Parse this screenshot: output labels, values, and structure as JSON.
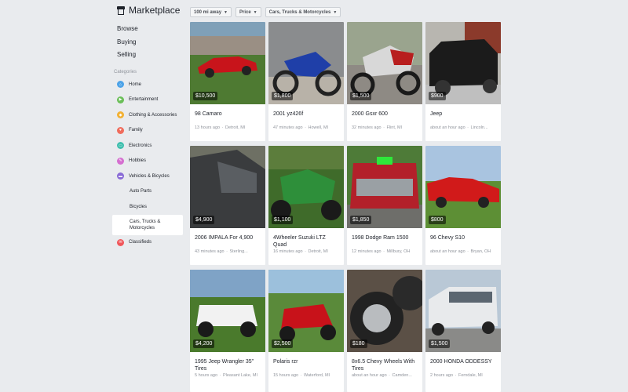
{
  "brand": {
    "title": "Marketplace"
  },
  "nav": [
    {
      "label": "Browse"
    },
    {
      "label": "Buying"
    },
    {
      "label": "Selling"
    }
  ],
  "categories_heading": "Categories",
  "categories": [
    {
      "label": "Home",
      "icon": "home-icon",
      "color": "#4da3e8"
    },
    {
      "label": "Entertainment",
      "icon": "entertainment-icon",
      "color": "#6bbf59"
    },
    {
      "label": "Clothing & Accessories",
      "icon": "clothing-icon",
      "color": "#f2b134"
    },
    {
      "label": "Family",
      "icon": "heart-icon",
      "color": "#f06c5c"
    },
    {
      "label": "Electronics",
      "icon": "electronics-icon",
      "color": "#3fbfae"
    },
    {
      "label": "Hobbies",
      "icon": "hobbies-icon",
      "color": "#d56fd0"
    },
    {
      "label": "Vehicles & Bicycles",
      "icon": "vehicle-icon",
      "color": "#8a6bd6"
    },
    {
      "label": "Auto Parts",
      "sub": true
    },
    {
      "label": "Bicycles",
      "sub": true
    },
    {
      "label": "Cars, Trucks & Motorcycles",
      "sub": true,
      "selected": true
    },
    {
      "label": "Classifieds",
      "icon": "classifieds-icon",
      "color": "#f0565a"
    }
  ],
  "filters": [
    {
      "label": "100 mi away"
    },
    {
      "label": "Price"
    },
    {
      "label": "Cars, Trucks & Motorcycles"
    }
  ],
  "listings": [
    {
      "price": "$10,500",
      "title": "98 Camaro",
      "time": "13 hours ago",
      "location": "Detroit, MI"
    },
    {
      "price": "$1,800",
      "title": "2001 yz426f",
      "time": "47 minutes ago",
      "location": "Howell, MI"
    },
    {
      "price": "$1,500",
      "title": "2000 Gsxr 600",
      "time": "32 minutes ago",
      "location": "Flint, MI"
    },
    {
      "price": "$900",
      "title": "Jeep",
      "time": "about an hour ago",
      "location": "Lincoln..."
    },
    {
      "price": "$4,900",
      "title": "2006 IMPALA For 4,900",
      "time": "43 minutes ago",
      "location": "Sterling..."
    },
    {
      "price": "$1,100",
      "title": "4Wheeler Suzuki LTZ Quad",
      "time": "16 minutes ago",
      "location": "Detroit, MI"
    },
    {
      "price": "$1,850",
      "title": "1998 Dodge Ram 1500",
      "time": "12 minutes ago",
      "location": "Millbury, OH"
    },
    {
      "price": "$800",
      "title": "96 Chevy S10",
      "time": "about an hour ago",
      "location": "Bryan, OH"
    },
    {
      "price": "$4,200",
      "title": "1995 Jeep Wrangler 35\" Tires",
      "time": "5 hours ago",
      "location": "Pleasant Lake, MI"
    },
    {
      "price": "$2,500",
      "title": "Polaris rzr",
      "time": "15 hours ago",
      "location": "Waterford, MI"
    },
    {
      "price": "$180",
      "title": "8x6.5 Chevy Wheels With Tires",
      "time": "about an hour ago",
      "location": "Camden..."
    },
    {
      "price": "$1,500",
      "title": "2000 HONDA ODDESSY",
      "time": "2 hours ago",
      "location": "Ferndale, MI"
    }
  ]
}
